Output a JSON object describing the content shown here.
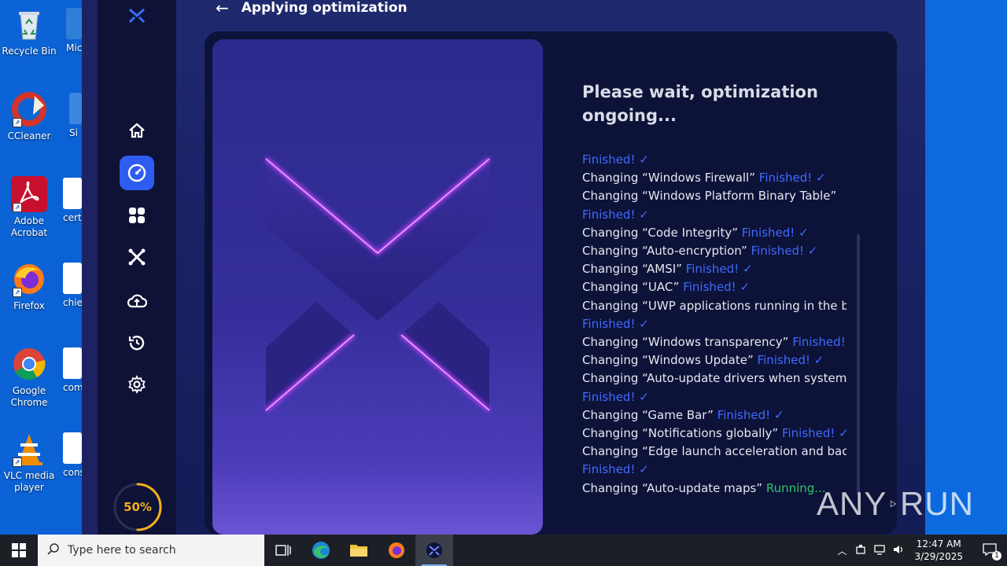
{
  "desktop": {
    "icons": [
      {
        "label": "Recycle Bin",
        "name": "recycle-bin"
      },
      {
        "label": "CCleaner",
        "name": "ccleaner"
      },
      {
        "label": "Adobe Acrobat",
        "name": "adobe-acrobat"
      },
      {
        "label": "Firefox",
        "name": "firefox"
      },
      {
        "label": "Google Chrome",
        "name": "google-chrome"
      },
      {
        "label": "VLC media player",
        "name": "vlc-media-player"
      }
    ],
    "partial_icons": [
      {
        "label": "Mic"
      },
      {
        "label": "Si"
      },
      {
        "label": "certi"
      },
      {
        "label": "chief"
      },
      {
        "label": "com"
      },
      {
        "label": "cons"
      }
    ]
  },
  "app": {
    "header": {
      "title": "Applying optimization"
    },
    "sidebar": {
      "items": [
        "home-icon",
        "speedometer-icon",
        "apps-grid-icon",
        "tools-icon",
        "cloud-upload-icon",
        "history-icon",
        "settings-icon"
      ],
      "active_index": 1,
      "progress_label": "50%",
      "progress": 50
    },
    "status_title": "Please wait, optimization ongoing...",
    "log": [
      {
        "text": "",
        "status": "Finished!",
        "state": "done"
      },
      {
        "text": "Changing “Windows Firewall”",
        "status": "Finished!",
        "state": "done"
      },
      {
        "text": "Changing “Windows Platform Binary Table”",
        "status": "",
        "state": ""
      },
      {
        "text": "",
        "status": "Finished!",
        "state": "done"
      },
      {
        "text": "Changing “Code Integrity”",
        "status": "Finished!",
        "state": "done"
      },
      {
        "text": "Changing “Auto-encryption”",
        "status": "Finished!",
        "state": "done"
      },
      {
        "text": "Changing “AMSI”",
        "status": "Finished!",
        "state": "done"
      },
      {
        "text": "Changing “UAC”",
        "status": "Finished!",
        "state": "done"
      },
      {
        "text": "Changing “UWP applications running in the backg",
        "status": "",
        "state": ""
      },
      {
        "text": "",
        "status": "Finished!",
        "state": "done"
      },
      {
        "text": "Changing “Windows transparency”",
        "status": "Finished!",
        "state": "done"
      },
      {
        "text": "Changing “Windows Update”",
        "status": "Finished!",
        "state": "done"
      },
      {
        "text": "Changing “Auto-update drivers when system starts",
        "status": "",
        "state": ""
      },
      {
        "text": "",
        "status": "Finished!",
        "state": "done"
      },
      {
        "text": "Changing “Game Bar”",
        "status": "Finished!",
        "state": "done"
      },
      {
        "text": "Changing “Notifications globally”",
        "status": "Finished!",
        "state": "done"
      },
      {
        "text": "Changing “Edge launch acceleration and backgro",
        "status": "",
        "state": ""
      },
      {
        "text": "",
        "status": "Finished!",
        "state": "done"
      },
      {
        "text": "Changing “Auto-update maps”",
        "status": "Running...",
        "state": "running"
      }
    ]
  },
  "watermark": {
    "left": "ANY",
    "right": "RUN"
  },
  "taskbar": {
    "search_placeholder": "Type here to search",
    "time": "12:47 AM",
    "date": "3/29/2025",
    "notification_count": "1"
  },
  "colors": {
    "accent": "#2f5cf0",
    "finished": "#3f6bff",
    "running": "#2fc46a",
    "progress": "#f2b01c"
  }
}
